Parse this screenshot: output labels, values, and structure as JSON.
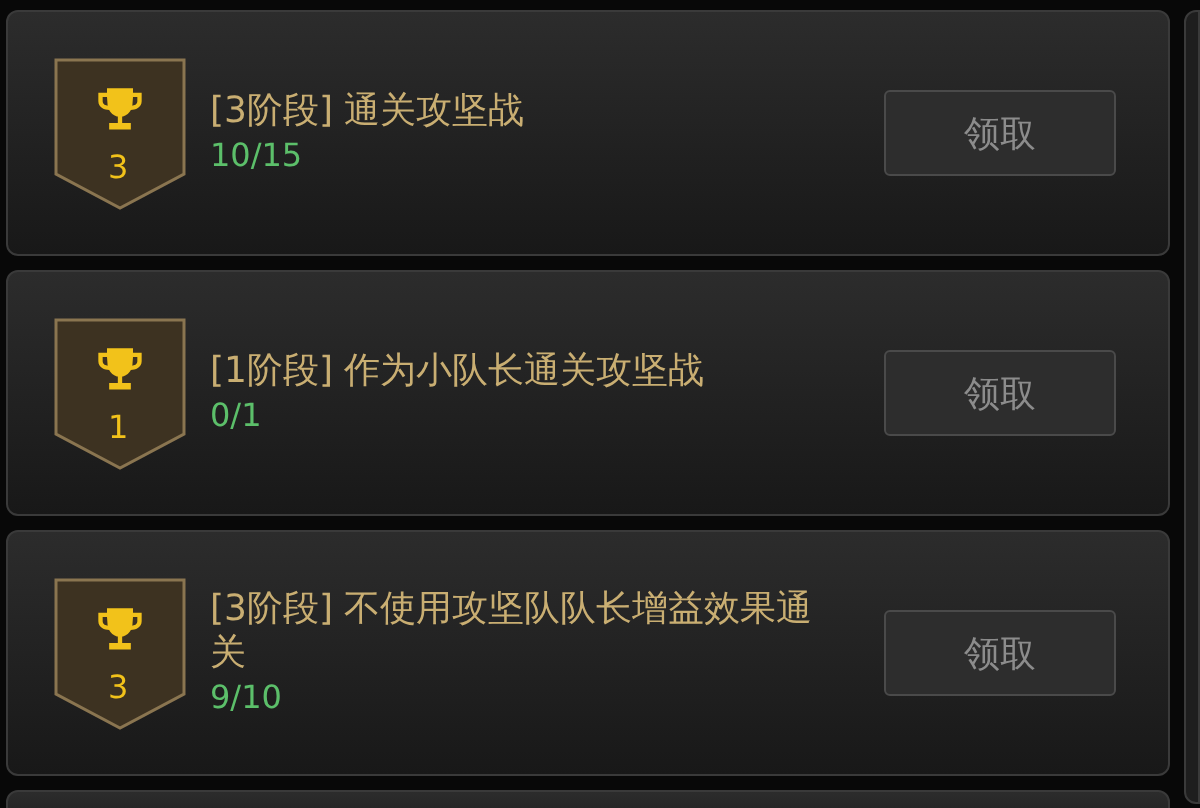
{
  "tasks": [
    {
      "level": "3",
      "title": "[3阶段] 通关攻坚战",
      "progress": "10/15",
      "button": "领取"
    },
    {
      "level": "1",
      "title": "[1阶段] 作为小队长通关攻坚战",
      "progress": "0/1",
      "button": "领取"
    },
    {
      "level": "3",
      "title": "[3阶段] 不使用攻坚队队长增益效果通关",
      "progress": "9/10",
      "button": "领取"
    }
  ]
}
